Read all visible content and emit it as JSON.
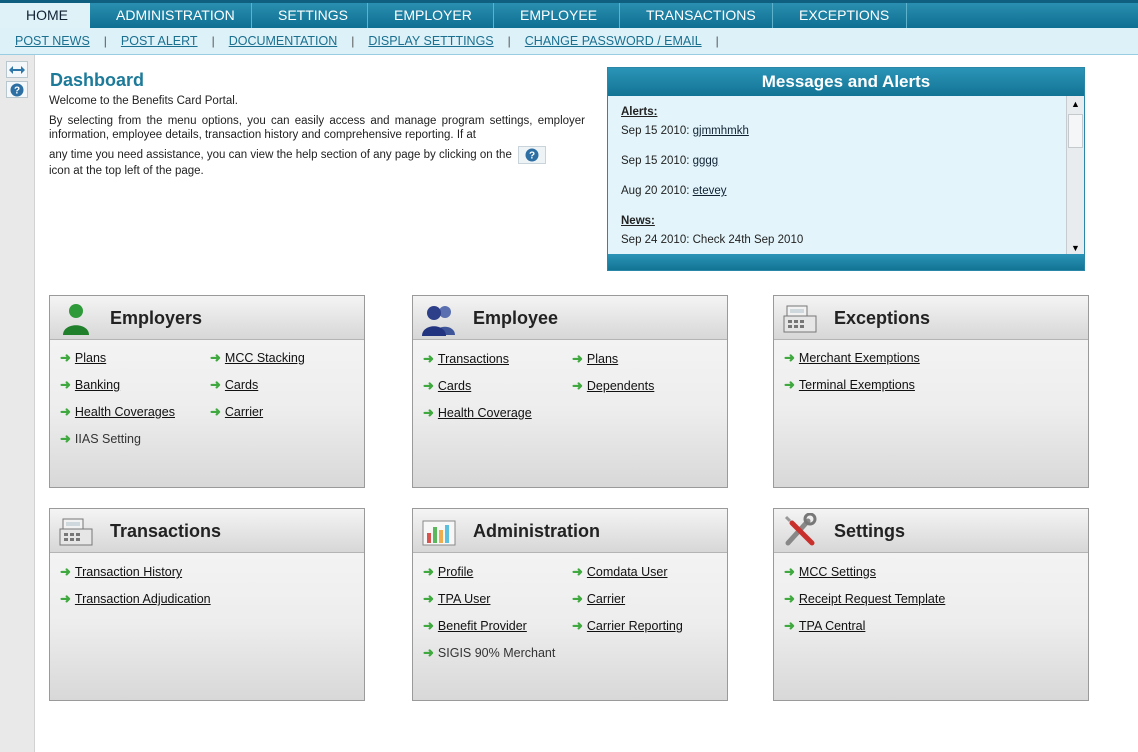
{
  "topnav": [
    "HOME",
    "ADMINISTRATION",
    "SETTINGS",
    "EMPLOYER",
    "EMPLOYEE",
    "TRANSACTIONS",
    "EXCEPTIONS"
  ],
  "subnav": [
    "POST NEWS",
    "POST ALERT",
    "DOCUMENTATION",
    "DISPLAY SETTTINGS",
    "CHANGE PASSWORD / EMAIL"
  ],
  "subnav_sep": "|",
  "dashboard": {
    "title": "Dashboard",
    "welcome": "Welcome to the Benefits Card Portal.",
    "intro": "By selecting from the menu options, you can easily access and manage program settings, employer information, employee details, transaction history and comprehensive reporting. If at",
    "intro2a": "any time you need assistance, you can view the help section of any page by clicking on the",
    "intro2b": "icon at the top left of the page."
  },
  "messages": {
    "title": "Messages and Alerts",
    "alerts_label": "Alerts:",
    "alerts": [
      {
        "date": "Sep 15 2010:",
        "link": "gjmmhmkh"
      },
      {
        "date": "Sep 15 2010:",
        "link": "gggg"
      },
      {
        "date": "Aug 20 2010:",
        "link": "etevey"
      }
    ],
    "news_label": "News:",
    "news": [
      {
        "date": "Sep 24 2010:",
        "text": "Check 24th Sep 2010"
      }
    ]
  },
  "cards": {
    "employers": {
      "title": "Employers",
      "links": [
        "Plans",
        "MCC Stacking",
        "Banking",
        "Cards",
        "Health Coverages",
        "Carrier",
        "IIAS Setting"
      ]
    },
    "employee": {
      "title": "Employee",
      "links": [
        "Transactions",
        "Plans",
        "Cards",
        "Dependents",
        "Health Coverage"
      ]
    },
    "exceptions": {
      "title": "Exceptions",
      "links": [
        "Merchant Exemptions",
        "Terminal Exemptions"
      ]
    },
    "transactions": {
      "title": "Transactions",
      "links": [
        "Transaction History",
        "Transaction Adjudication"
      ]
    },
    "administration": {
      "title": "Administration",
      "links": [
        "Profile",
        "Comdata User",
        "TPA User",
        "Carrier",
        "Benefit Provider",
        "Carrier Reporting",
        "SIGIS 90% Merchant"
      ]
    },
    "settings": {
      "title": "Settings",
      "links": [
        "MCC Settings",
        "Receipt Request Template",
        "TPA Central"
      ]
    }
  }
}
